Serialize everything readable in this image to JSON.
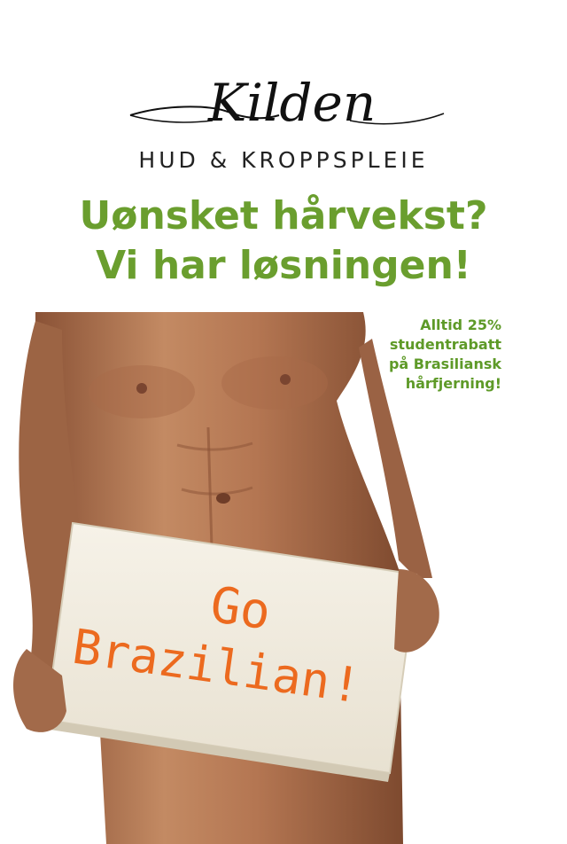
{
  "brand": {
    "name": "Kilden",
    "subtitle": "HUD & KROPPSPLEIE"
  },
  "headline": {
    "line1": "Uønsket hårvekst?",
    "line2": "Vi har løsningen!"
  },
  "promo": {
    "lines": [
      "Alltid 25%",
      "studentrabatt",
      "på Brasiliansk",
      "hårfjerning!"
    ]
  },
  "sign": {
    "line1": "Go",
    "line2": "Brazilian",
    "exclaim": "!"
  },
  "colors": {
    "headline": "#6a9e2e",
    "promo": "#5e9a28",
    "sign_text": "#ec6a1f",
    "sign_board": "#f2ede1",
    "skin": "#b57a55"
  }
}
